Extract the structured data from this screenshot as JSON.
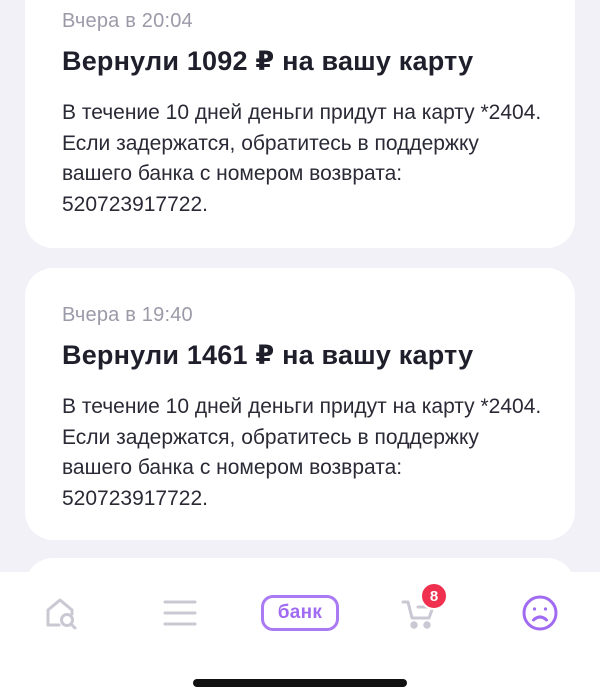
{
  "notifications": [
    {
      "time": "Вчера в 20:04",
      "title": "Вернули 1092 ₽ на вашу карту",
      "body": "В течение 10 дней деньги придут на карту *2404. Если задержатся, обратитесь в поддержку вашего банка с номером возврата: 520723917722."
    },
    {
      "time": "Вчера в 19:40",
      "title": "Вернули 1461 ₽ на вашу карту",
      "body": "В течение 10 дней деньги придут на карту *2404. Если задержатся, обратитесь в поддержку вашего банка с номером возврата: 520723917722."
    }
  ],
  "tabbar": {
    "bank_label": "банк",
    "cart_badge": "8",
    "icons": [
      "home-search-icon",
      "menu-icon",
      "bank-icon",
      "cart-icon",
      "profile-icon"
    ],
    "colors": {
      "inactive": "#c9c8d3",
      "accent": "#a06bf2",
      "badge": "#f0304f"
    }
  }
}
